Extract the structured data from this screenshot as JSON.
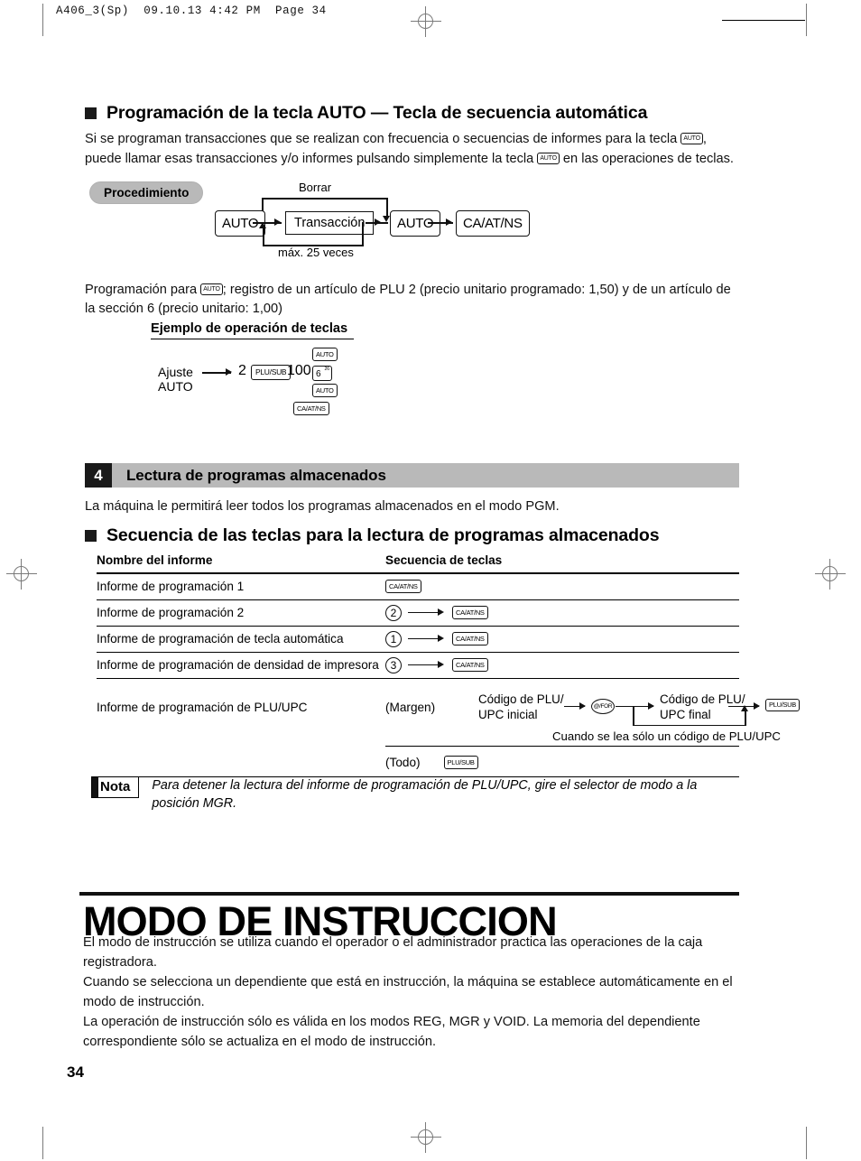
{
  "page": {
    "header_line": "A406_3(Sp)  09.10.13 4:42 PM  Page 34",
    "page_number": "34"
  },
  "auto_key_section": {
    "heading": "Programación de la tecla AUTO — Tecla de secuencia automática",
    "intro_line1_a": "Si se programan transacciones que se realizan con frecuencia o secuencias de informes para la tecla",
    "intro_line1_key": "AUTO",
    "intro_line1_b": ",",
    "intro_line2_a": "puede llamar esas transacciones y/o informes pulsando simplemente la tecla",
    "intro_line2_key": "AUTO",
    "intro_line2_b": "en las operaciones de teclas.",
    "procedure_label": "Procedimiento",
    "diagram": {
      "clear_label": "Borrar",
      "max_label": "máx. 25 veces",
      "key_auto_1": "AUTO",
      "box_transaction": "Transacción",
      "key_auto_2": "AUTO",
      "key_caatns": "CA/AT/NS"
    },
    "example_para_a": "Programación para",
    "example_para_key": "AUTO",
    "example_para_b": "; registro de un artículo de PLU 2 (precio unitario programado: 1,50) y de un artículo de",
    "example_para_line2": "la sección 6 (precio unitario: 1,00)",
    "example_heading": "Ejemplo de operación de teclas",
    "example_keys": {
      "label_line1": "Ajuste",
      "label_line2": "AUTO",
      "num_2": "2",
      "key_plusub": "PLU/SUB",
      "num_100": "100",
      "key_auto_top": "AUTO",
      "dept_key_num": "6",
      "dept_key_sup": "26",
      "key_auto_bottom": "AUTO",
      "key_caatns": "CA/AT/NS"
    }
  },
  "section4": {
    "number": "4",
    "title": "Lectura de programas almacenados",
    "intro": "La máquina le permitirá leer todos los programas almacenados en el modo PGM.",
    "subheading": "Secuencia de las teclas para la lectura de programas almacenados",
    "table": {
      "col1_header": "Nombre del informe",
      "col2_header": "Secuencia de teclas",
      "rows": [
        {
          "name": "Informe de programación 1",
          "num": "",
          "key": "CA/AT/NS"
        },
        {
          "name": "Informe de programación 2",
          "num": "2",
          "key": "CA/AT/NS"
        },
        {
          "name": "Informe de programación de tecla automática",
          "num": "1",
          "key": "CA/AT/NS"
        },
        {
          "name": "Informe de programación de densidad de impresora",
          "num": "3",
          "key": "CA/AT/NS"
        }
      ],
      "plu_row": {
        "name": "Informe de programación de PLU/UPC",
        "range_label": "(Margen)",
        "start_code_line1": "Código de PLU/",
        "start_code_line2": "UPC inicial",
        "at_for_key": "@/FOR",
        "end_code_line1": "Código de PLU/",
        "end_code_line2": "UPC final",
        "plusub_key": "PLU/SUB",
        "single_note": "Cuando se lea sólo un código de PLU/UPC",
        "all_label": "(Todo)",
        "all_key": "PLU/SUB"
      }
    },
    "note": {
      "label": "Nota",
      "text": "Para detener la lectura del informe de programación de PLU/UPC, gire el selector de modo a la posición MGR."
    }
  },
  "chapter": {
    "title": "MODO DE INSTRUCCION",
    "para1_line1": "El modo de instrucción se utiliza cuando el operador o el administrador practica las operaciones de la caja",
    "para1_line2": "registradora.",
    "para2_line1": "Cuando se selecciona un dependiente que está en instrucción, la máquina se establece automáticamente en el",
    "para2_line2": "modo de instrucción.",
    "para3_line1": "La operación de instrucción sólo es válida en los modos REG, MGR y VOID. La memoria del dependiente",
    "para3_line2": "correspondiente sólo se actualiza en el modo de instrucción."
  }
}
